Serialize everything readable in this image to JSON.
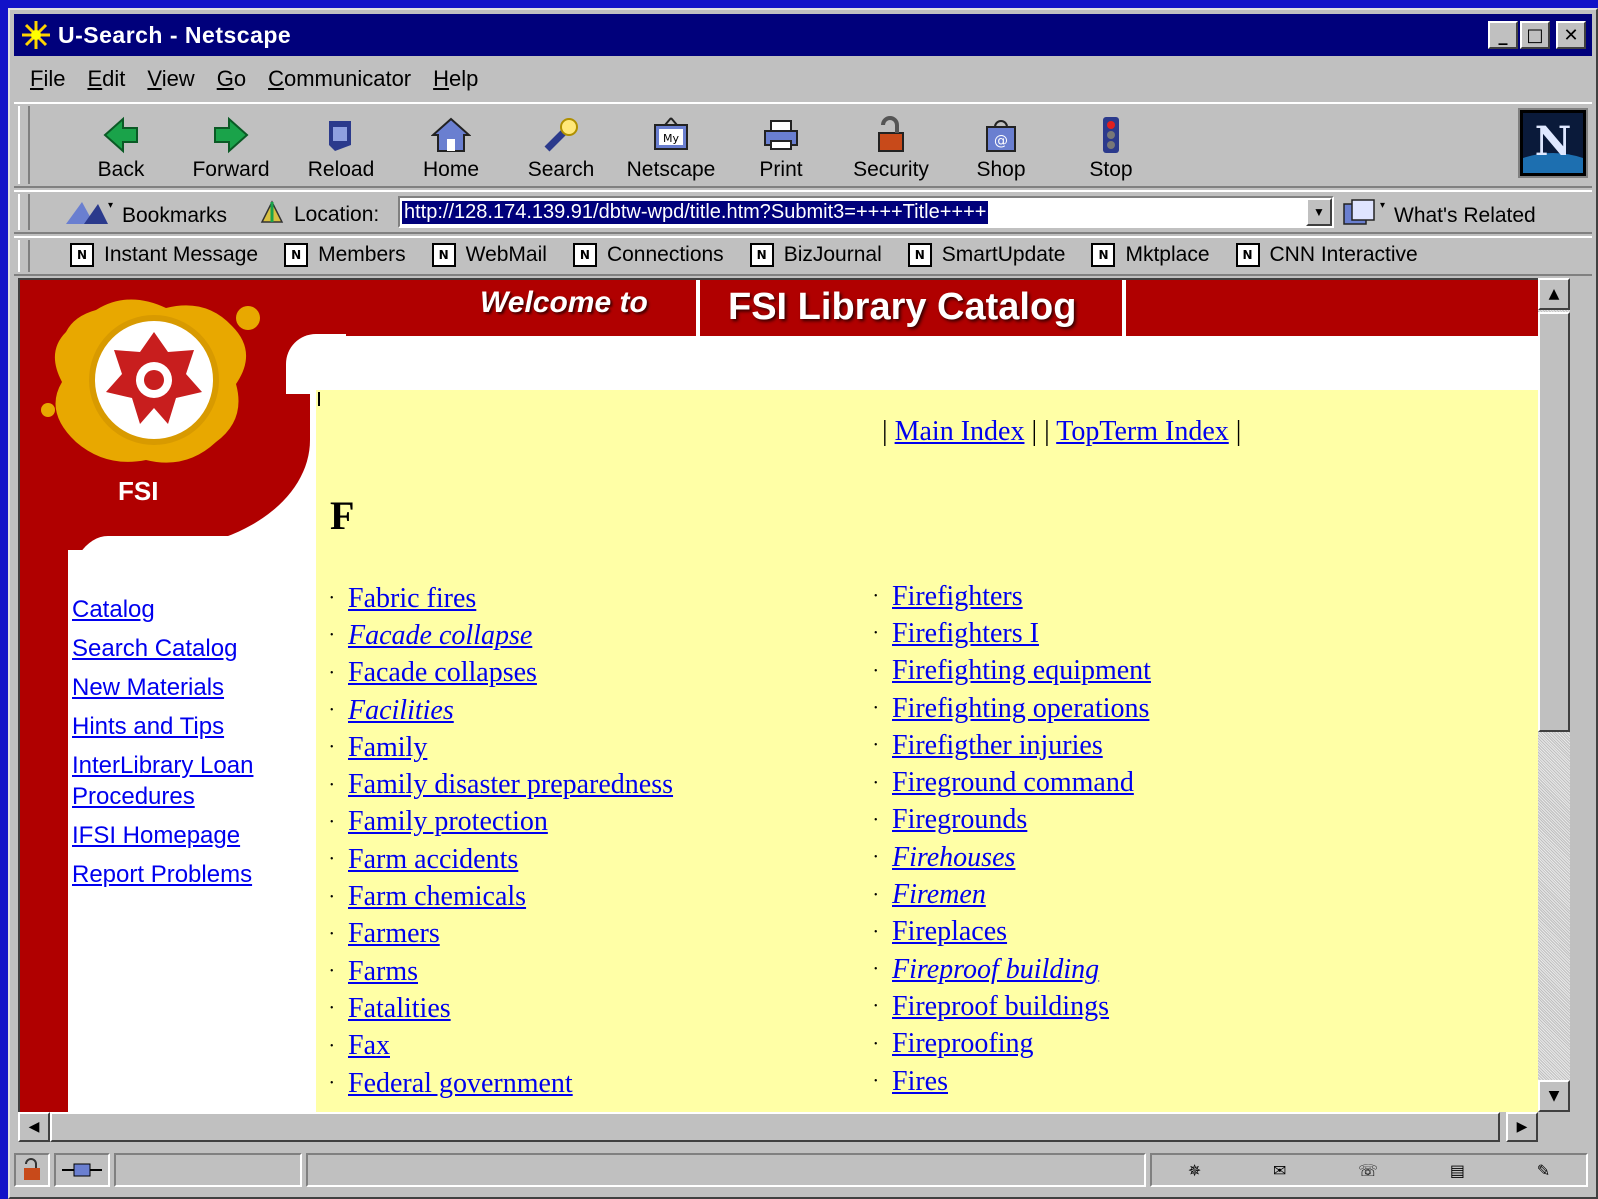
{
  "window": {
    "title": "U-Search - Netscape"
  },
  "title_buttons": {
    "minimize": "_",
    "maximize": "□",
    "close": "✕"
  },
  "menu": [
    {
      "label": "File",
      "key": "F",
      "rest": "ile"
    },
    {
      "label": "Edit",
      "key": "E",
      "rest": "dit"
    },
    {
      "label": "View",
      "key": "V",
      "rest": "iew"
    },
    {
      "label": "Go",
      "key": "G",
      "rest": "o"
    },
    {
      "label": "Communicator",
      "key": "C",
      "rest": "ommunicator"
    },
    {
      "label": "Help",
      "key": "H",
      "rest": "elp"
    }
  ],
  "toolbar": {
    "back": "Back",
    "forward": "Forward",
    "reload": "Reload",
    "home": "Home",
    "search": "Search",
    "netscape": "Netscape",
    "print": "Print",
    "security": "Security",
    "shop": "Shop",
    "stop": "Stop"
  },
  "location_bar": {
    "bookmarks_label": "Bookmarks",
    "location_label": "Location:",
    "url": "http://128.174.139.91/dbtw-wpd/title.htm?Submit3=++++Title++++",
    "related_label": "What's Related"
  },
  "personal_bar": {
    "items": [
      "Instant Message",
      "Members",
      "WebMail",
      "Connections",
      "BizJournal",
      "SmartUpdate",
      "Mktplace",
      "CNN Interactive"
    ]
  },
  "page": {
    "welcome": "Welcome to",
    "title": "FSI Library Catalog",
    "logo_text": "FSI",
    "sidebar_links": [
      "Catalog",
      "Search Catalog",
      "New Materials ",
      "Hints and Tips",
      "InterLibrary Loan",
      "Procedures",
      "IFSI Homepage",
      "Report Problems"
    ],
    "index_links": {
      "main": "Main Index",
      "topterm": "TopTerm Index"
    },
    "letter": "F",
    "column_left": [
      {
        "text": "Fabric fires",
        "italic": false
      },
      {
        "text": "Facade collapse",
        "italic": true
      },
      {
        "text": "Facade collapses",
        "italic": false
      },
      {
        "text": "Facilities",
        "italic": true
      },
      {
        "text": "Family",
        "italic": false
      },
      {
        "text": "Family disaster preparedness",
        "italic": false
      },
      {
        "text": "Family protection",
        "italic": false
      },
      {
        "text": "Farm accidents",
        "italic": false
      },
      {
        "text": "Farm chemicals",
        "italic": false
      },
      {
        "text": "Farmers",
        "italic": false
      },
      {
        "text": "Farms",
        "italic": false
      },
      {
        "text": "Fatalities",
        "italic": false
      },
      {
        "text": "Fax",
        "italic": false
      },
      {
        "text": "Federal government",
        "italic": false
      }
    ],
    "column_right": [
      {
        "text": "Firefighters",
        "italic": false
      },
      {
        "text": "Firefighters I",
        "italic": false
      },
      {
        "text": "Firefighting equipment",
        "italic": false
      },
      {
        "text": "Firefighting operations",
        "italic": false
      },
      {
        "text": "Firefigther injuries",
        "italic": false
      },
      {
        "text": "Fireground command",
        "italic": false
      },
      {
        "text": "Firegrounds",
        "italic": false
      },
      {
        "text": "Firehouses",
        "italic": true
      },
      {
        "text": "Firemen",
        "italic": true
      },
      {
        "text": "Fireplaces",
        "italic": false
      },
      {
        "text": "Fireproof building",
        "italic": true
      },
      {
        "text": "Fireproof buildings",
        "italic": false
      },
      {
        "text": "Fireproofing",
        "italic": false
      },
      {
        "text": "Fires",
        "italic": false
      }
    ]
  },
  "colors": {
    "accent_red": "#b00000",
    "content_yellow": "#ffffa6",
    "link_blue": "#0000ee",
    "titlebar_blue": "#00007b"
  }
}
